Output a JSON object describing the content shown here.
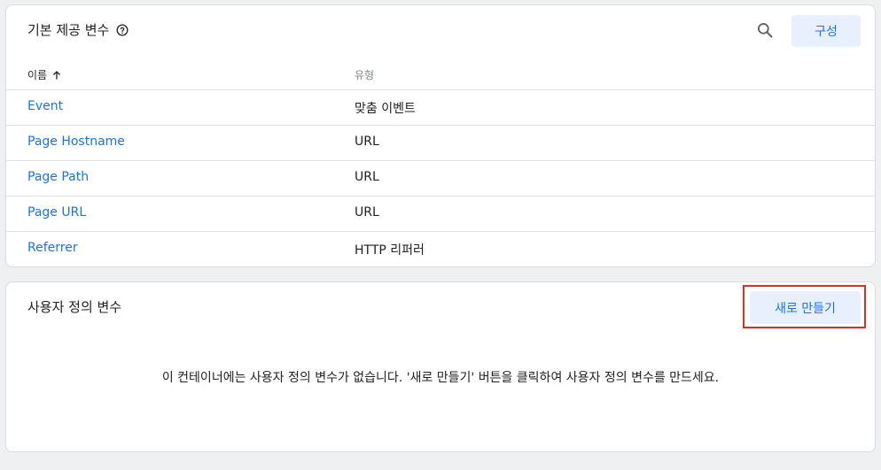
{
  "builtin": {
    "title": "기본 제공 변수",
    "configure_label": "구성",
    "columns": {
      "name": "이름",
      "type": "유형"
    },
    "rows": [
      {
        "name": "Event",
        "type": "맞춤 이벤트"
      },
      {
        "name": "Page Hostname",
        "type": "URL"
      },
      {
        "name": "Page Path",
        "type": "URL"
      },
      {
        "name": "Page URL",
        "type": "URL"
      },
      {
        "name": "Referrer",
        "type": "HTTP 리퍼러"
      }
    ]
  },
  "user_defined": {
    "title": "사용자 정의 변수",
    "new_label": "새로 만들기",
    "empty_message": "이 컨테이너에는 사용자 정의 변수가 없습니다. '새로 만들기' 버튼을 클릭하여 사용자 정의 변수를 만드세요."
  },
  "colors": {
    "accent": "#1a73e8",
    "button_bg": "#e8f0fe",
    "highlight": "#d93025"
  },
  "icons": {
    "help": "help-circle-icon",
    "search": "search-icon",
    "sort": "arrow-up-icon"
  }
}
